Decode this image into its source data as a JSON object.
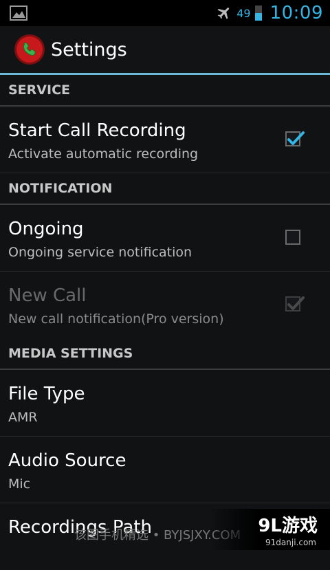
{
  "status_bar": {
    "image_icon": "image-notification-icon",
    "airplane_icon": "airplane-mode-icon",
    "battery_level": "49",
    "time": "10:09",
    "accent_color": "#33b5e5"
  },
  "action_bar": {
    "app_icon": "call-recorder-icon",
    "title": "Settings"
  },
  "sections": {
    "service": {
      "header": "SERVICE",
      "items": [
        {
          "title": "Start Call Recording",
          "subtitle": "Activate automatic recording",
          "checked": true,
          "enabled": true
        }
      ]
    },
    "notification": {
      "header": "NOTIFICATION",
      "items": [
        {
          "title": "Ongoing",
          "subtitle": "Ongoing service notification",
          "checked": false,
          "enabled": true
        },
        {
          "title": "New Call",
          "subtitle": "New call notification(Pro version)",
          "checked": true,
          "enabled": false
        }
      ]
    },
    "media": {
      "header": "MEDIA SETTINGS",
      "items": [
        {
          "title": "File Type",
          "subtitle": "AMR"
        },
        {
          "title": "Audio Source",
          "subtitle": "Mic"
        },
        {
          "title": "Recordings Path",
          "subtitle": ""
        }
      ]
    }
  },
  "watermark": {
    "text": "该图手机精选 • BYJSJXY.COM",
    "logo_main": "9L游戏",
    "logo_sub": "91danji.com"
  },
  "colors": {
    "background": "#101214",
    "divider_accent": "#6bb8d8",
    "checkbox_check": "#33b5e5",
    "app_icon_red": "#c7191b",
    "app_icon_green": "#3bb24b"
  }
}
